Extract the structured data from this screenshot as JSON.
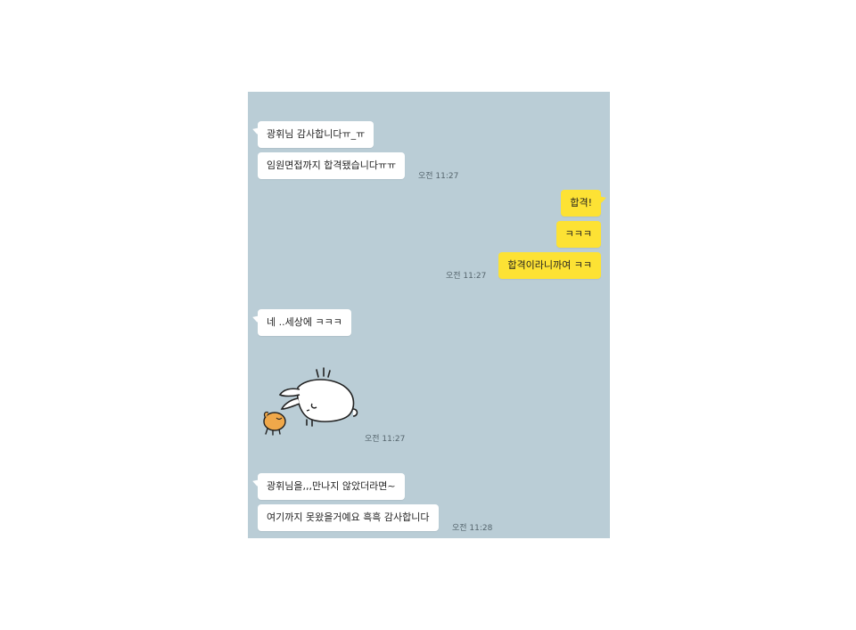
{
  "messages": {
    "m1": {
      "text": "광휘님 감사합니다ㅠ_ㅠ"
    },
    "m2": {
      "text": "임원면접까지 합격됐습니다ㅠㅠ",
      "time": "오전 11:27"
    },
    "m3": {
      "text": "합격!"
    },
    "m4": {
      "text": "ㅋㅋㅋ"
    },
    "m5": {
      "text": "합격이라니까여 ㅋㅋ",
      "time": "오전 11:27"
    },
    "m6": {
      "text": "네 ..세상에 ㅋㅋㅋ"
    },
    "sticker": {
      "time": "오전 11:27"
    },
    "m7": {
      "text": "광휘님을,,,만나지 않았더라면~"
    },
    "m8": {
      "text": "여기까지 못왔을거예요 흑흑 감사합니다",
      "time": "오전 11:28"
    }
  },
  "colors": {
    "chat_background": "#bacdd6",
    "incoming_bubble": "#ffffff",
    "outgoing_bubble": "#fde234"
  },
  "icons": {
    "sticker": "bunny-bowing-sticker"
  }
}
